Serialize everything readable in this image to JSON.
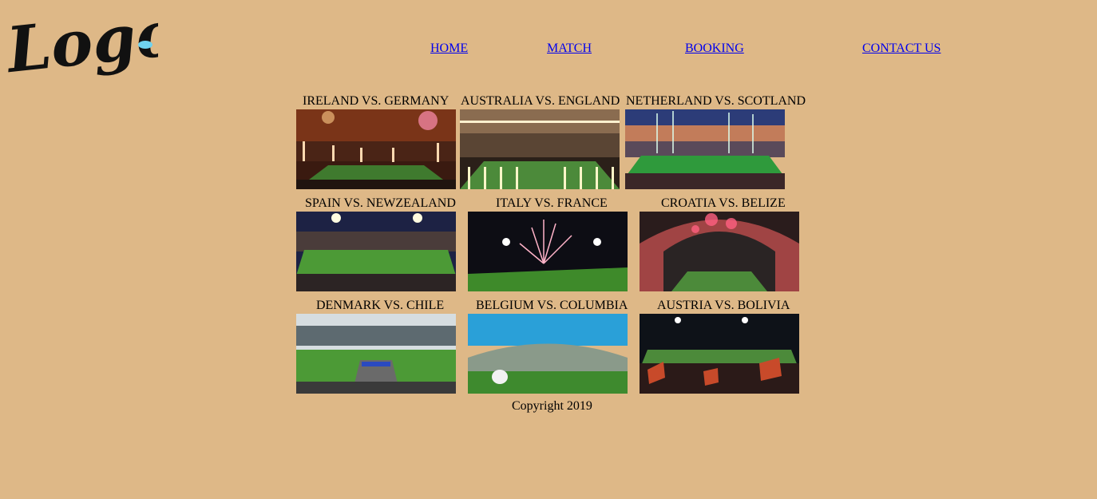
{
  "logo": {
    "text": "Logo",
    "dot_color": "#6FD3F0"
  },
  "nav": {
    "home": "HOME",
    "match": "MATCH",
    "booking": "BOOKING",
    "contact": "CONTACT US"
  },
  "matches": [
    {
      "title": "IRELAND VS. GERMANY",
      "icon": "stadium-fireworks-photo"
    },
    {
      "title": "AUSTRALIA VS. ENGLAND",
      "icon": "stadium-roof-fireworks-photo"
    },
    {
      "title": "NETHERLAND VS. SCOTLAND",
      "icon": "stadium-dusk-photo"
    },
    {
      "title": "SPAIN VS. NEWZEALAND",
      "icon": "stadium-night-photo"
    },
    {
      "title": "ITALY VS. FRANCE",
      "icon": "stadium-fireworks-night-photo"
    },
    {
      "title": "CROATIA VS. BELIZE",
      "icon": "stadium-red-fireworks-photo"
    },
    {
      "title": "DENMARK VS. CHILE",
      "icon": "stadium-pitch-ceremony-photo"
    },
    {
      "title": "BELGIUM VS. COLUMBIA",
      "icon": "stadium-rugby-ball-photo"
    },
    {
      "title": "AUSTRIA VS. BOLIVIA",
      "icon": "stadium-crowd-flags-photo"
    }
  ],
  "footer": {
    "copyright": "Copyright 2019"
  }
}
